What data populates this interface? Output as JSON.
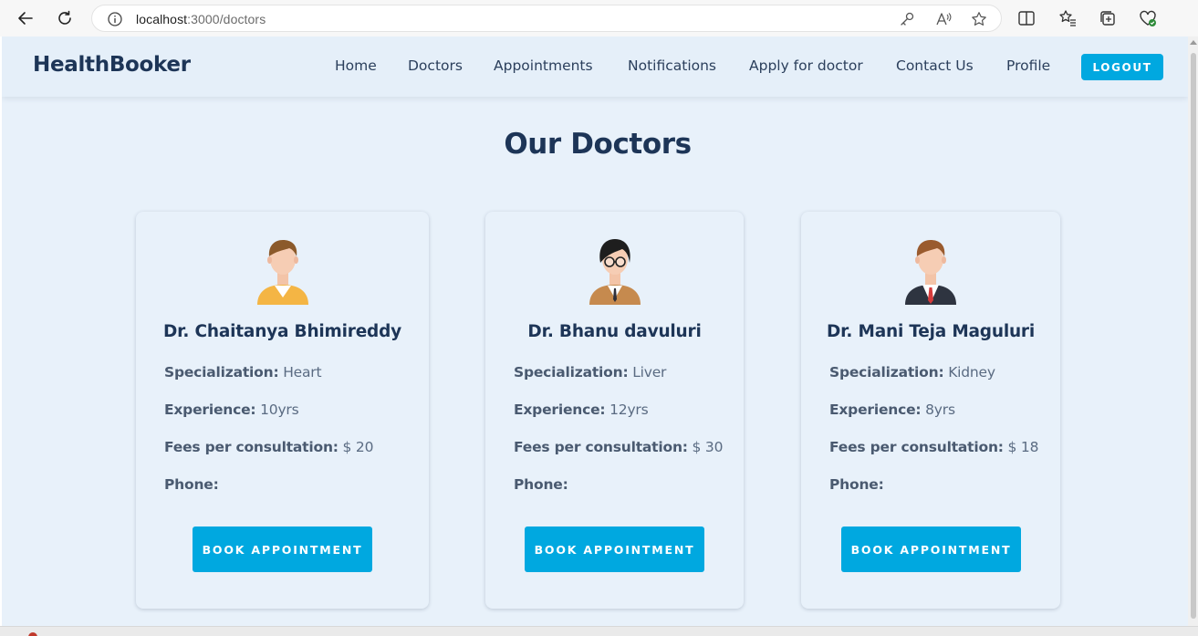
{
  "browser": {
    "url_host": "localhost",
    "url_path": ":3000/doctors"
  },
  "navbar": {
    "brand": "HealthBooker",
    "links": [
      "Home",
      "Doctors",
      "Appointments",
      "Notifications",
      "Apply for doctor",
      "Contact Us",
      "Profile"
    ],
    "logout_label": "LOGOUT"
  },
  "main": {
    "title": "Our Doctors",
    "doctors": [
      {
        "name": "Dr. Chaitanya Bhimireddy",
        "specialization_label": "Specialization:",
        "specialization": "Heart",
        "experience_label": "Experience:",
        "experience": "10yrs",
        "fees_label": "Fees per consultation:",
        "fees": "$ 20",
        "phone_label": "Phone:",
        "phone": "",
        "button_label": "BOOK APPOINTMENT",
        "avatar": "male-doctor-yellow-sweater-icon"
      },
      {
        "name": "Dr. Bhanu davuluri",
        "specialization_label": "Specialization:",
        "specialization": "Liver",
        "experience_label": "Experience:",
        "experience": "12yrs",
        "fees_label": "Fees per consultation:",
        "fees": "$ 30",
        "phone_label": "Phone:",
        "phone": "",
        "button_label": "BOOK APPOINTMENT",
        "avatar": "doctor-with-glasses-brown-suit-icon"
      },
      {
        "name": "Dr. Mani Teja Maguluri",
        "specialization_label": "Specialization:",
        "specialization": "Kidney",
        "experience_label": "Experience:",
        "experience": "8yrs",
        "fees_label": "Fees per consultation:",
        "fees": "$ 18",
        "phone_label": "Phone:",
        "phone": "",
        "button_label": "BOOK APPOINTMENT",
        "avatar": "male-doctor-dark-suit-red-tie-icon"
      }
    ]
  },
  "colors": {
    "brand_navy": "#1d3557",
    "accent_blue": "#00a8e0",
    "page_bg": "#e8f1fa"
  }
}
